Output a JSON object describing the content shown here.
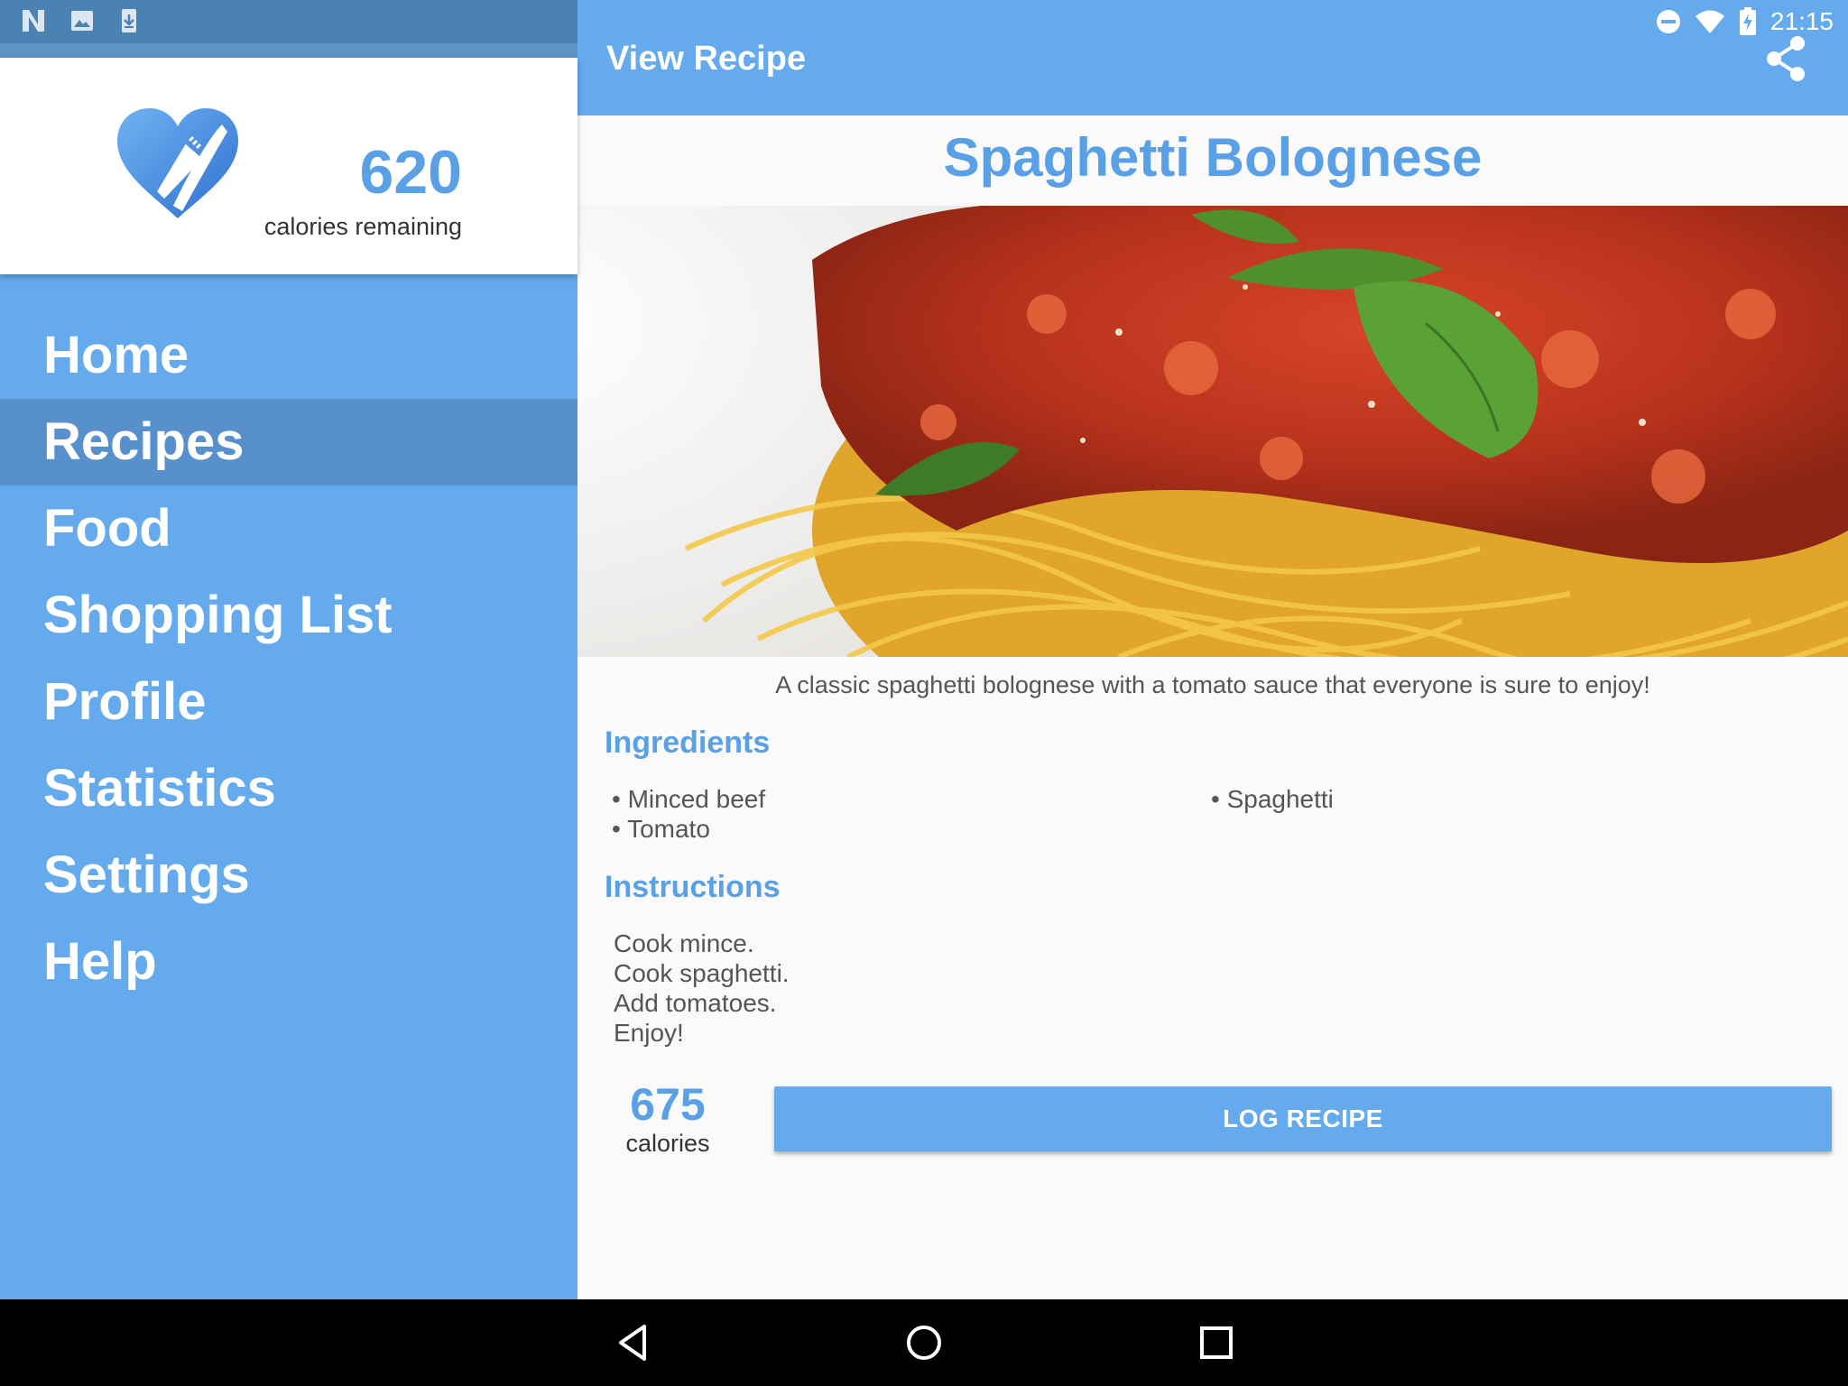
{
  "status_bar": {
    "time": "21:15",
    "left_icons": [
      "n-icon",
      "image-icon",
      "download-icon"
    ],
    "right_icons": [
      "dnd-icon",
      "wifi-icon",
      "battery-charging-icon"
    ]
  },
  "app_bar": {
    "title": "View Recipe",
    "share_icon": "share-icon",
    "color": "#64aaec"
  },
  "drawer": {
    "calories_remaining_value": "620",
    "calories_remaining_label": "calories remaining",
    "items": [
      {
        "label": "Home",
        "active": false
      },
      {
        "label": "Recipes",
        "active": true
      },
      {
        "label": "Food",
        "active": false
      },
      {
        "label": "Shopping List",
        "active": false
      },
      {
        "label": "Profile",
        "active": false
      },
      {
        "label": "Statistics",
        "active": false
      },
      {
        "label": "Settings",
        "active": false
      },
      {
        "label": "Help",
        "active": false
      }
    ]
  },
  "recipe": {
    "title": "Spaghetti Bolognese",
    "description": "A classic spaghetti bolognese with a tomato sauce that everyone is sure to enjoy!",
    "ingredients_heading": "Ingredients",
    "ingredients": [
      "• Minced beef",
      "• Tomato",
      "• Spaghetti"
    ],
    "instructions_heading": "Instructions",
    "instructions": [
      "Cook mince.",
      "Cook spaghetti.",
      "Add tomatoes.",
      "Enjoy!"
    ],
    "calories_value": "675",
    "calories_label": "calories",
    "log_button": "LOG RECIPE"
  },
  "nav_bar": {
    "icons": [
      "back-icon",
      "home-icon",
      "recents-icon"
    ]
  },
  "colors": {
    "accent": "#5aa0e6",
    "drawer_active": "#5790cb"
  }
}
